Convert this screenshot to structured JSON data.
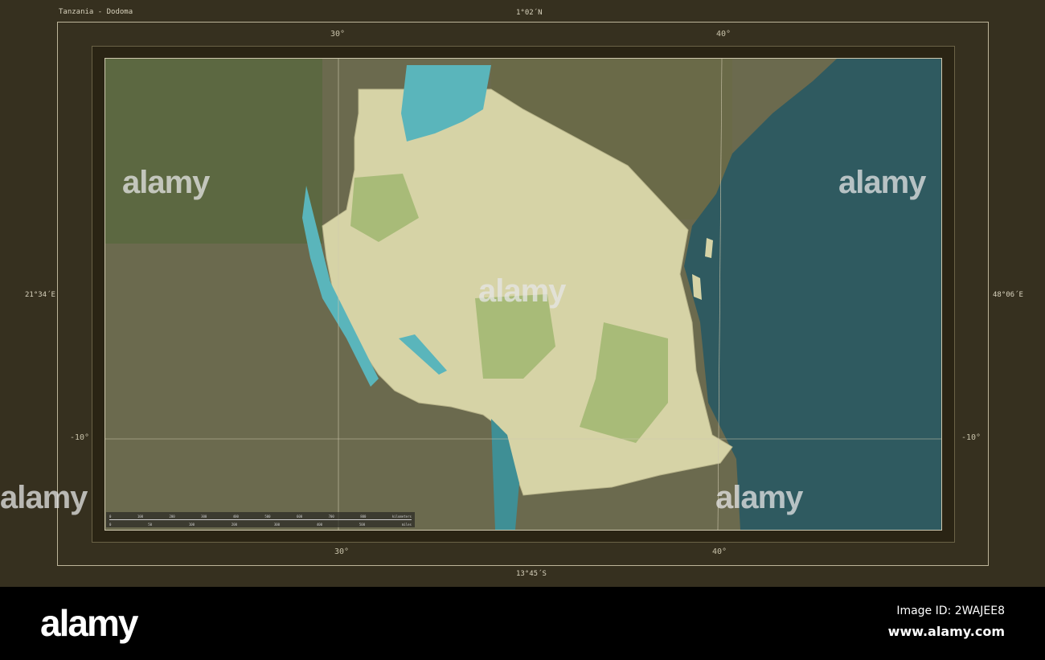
{
  "title": "Tanzania - Dodoma",
  "bounds": {
    "north": "1°02´N",
    "south": "13°45´S",
    "west": "21°34´E",
    "east": "48°06´E"
  },
  "grid_labels": {
    "top_30": "30°",
    "top_40": "40°",
    "bottom_30": "30°",
    "bottom_40": "40°",
    "left_m10": "-10°",
    "right_m10": "-10°"
  },
  "scale_bar": {
    "km": [
      "0",
      "100",
      "200",
      "300",
      "400",
      "500",
      "600",
      "700",
      "800",
      "kilometers"
    ],
    "mi": [
      "0",
      "50",
      "100",
      "200",
      "300",
      "400",
      "500",
      "miles"
    ]
  },
  "colors": {
    "land_highlight": "#d6d3a6",
    "water": "#5ab5bb",
    "ocean": "#2f5a60",
    "terrain": "#6b6a4e",
    "frame": "#36301f"
  },
  "watermark": "alamy",
  "footer": {
    "logo": "alamy",
    "image_id": "Image ID: 2WAJEE8",
    "site": "www.alamy.com"
  }
}
